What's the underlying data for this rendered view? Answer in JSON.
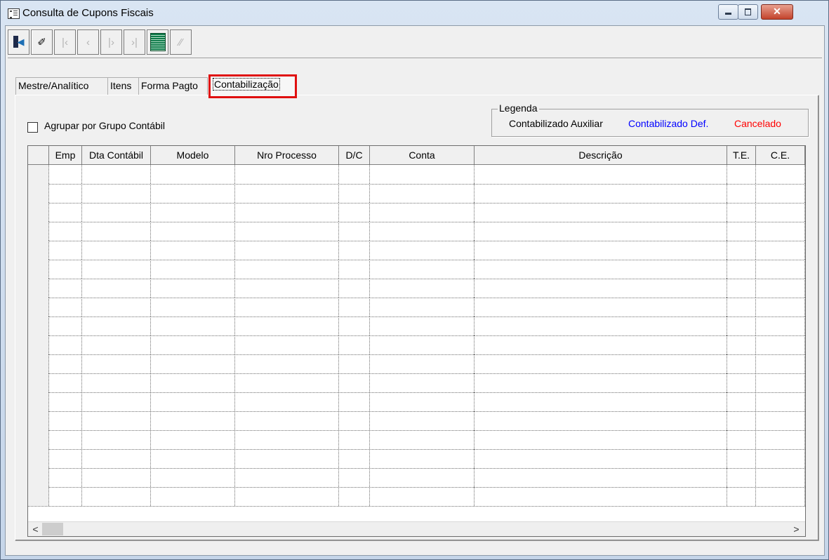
{
  "window": {
    "title": "Consulta de Cupons Fiscais",
    "close_glyph": "✕"
  },
  "toolbar": {
    "buttons": [
      {
        "name": "exit",
        "glyph": ""
      },
      {
        "name": "clear",
        "glyph": "✐"
      },
      {
        "name": "first",
        "glyph": "|‹"
      },
      {
        "name": "prev",
        "glyph": "‹"
      },
      {
        "name": "next",
        "glyph": "|›"
      },
      {
        "name": "last",
        "glyph": "›|"
      },
      {
        "name": "grid",
        "glyph": ""
      },
      {
        "name": "list",
        "glyph": "⁄⁄"
      }
    ]
  },
  "tabs": [
    "Mestre/Analítico",
    "Itens",
    "Forma Pagto",
    "Contabilização"
  ],
  "active_tab": "Contabilização",
  "checkbox": {
    "label": "Agrupar por Grupo Contábil",
    "checked": false
  },
  "legend": {
    "title": "Legenda",
    "items": [
      {
        "label": "Contabilizado Auxiliar",
        "color": "#000000"
      },
      {
        "label": "Contabilizado Def.",
        "color": "#0000ff"
      },
      {
        "label": "Cancelado",
        "color": "#ff0000"
      }
    ]
  },
  "grid": {
    "columns": [
      "Emp",
      "Dta Contábil",
      "Modelo",
      "Nro Processo",
      "D/C",
      "Conta",
      "Descrição",
      "T.E.",
      "C.E."
    ],
    "empty_rows": 18
  },
  "scrollbar": {
    "left_arrow": "<",
    "right_arrow": ">"
  }
}
